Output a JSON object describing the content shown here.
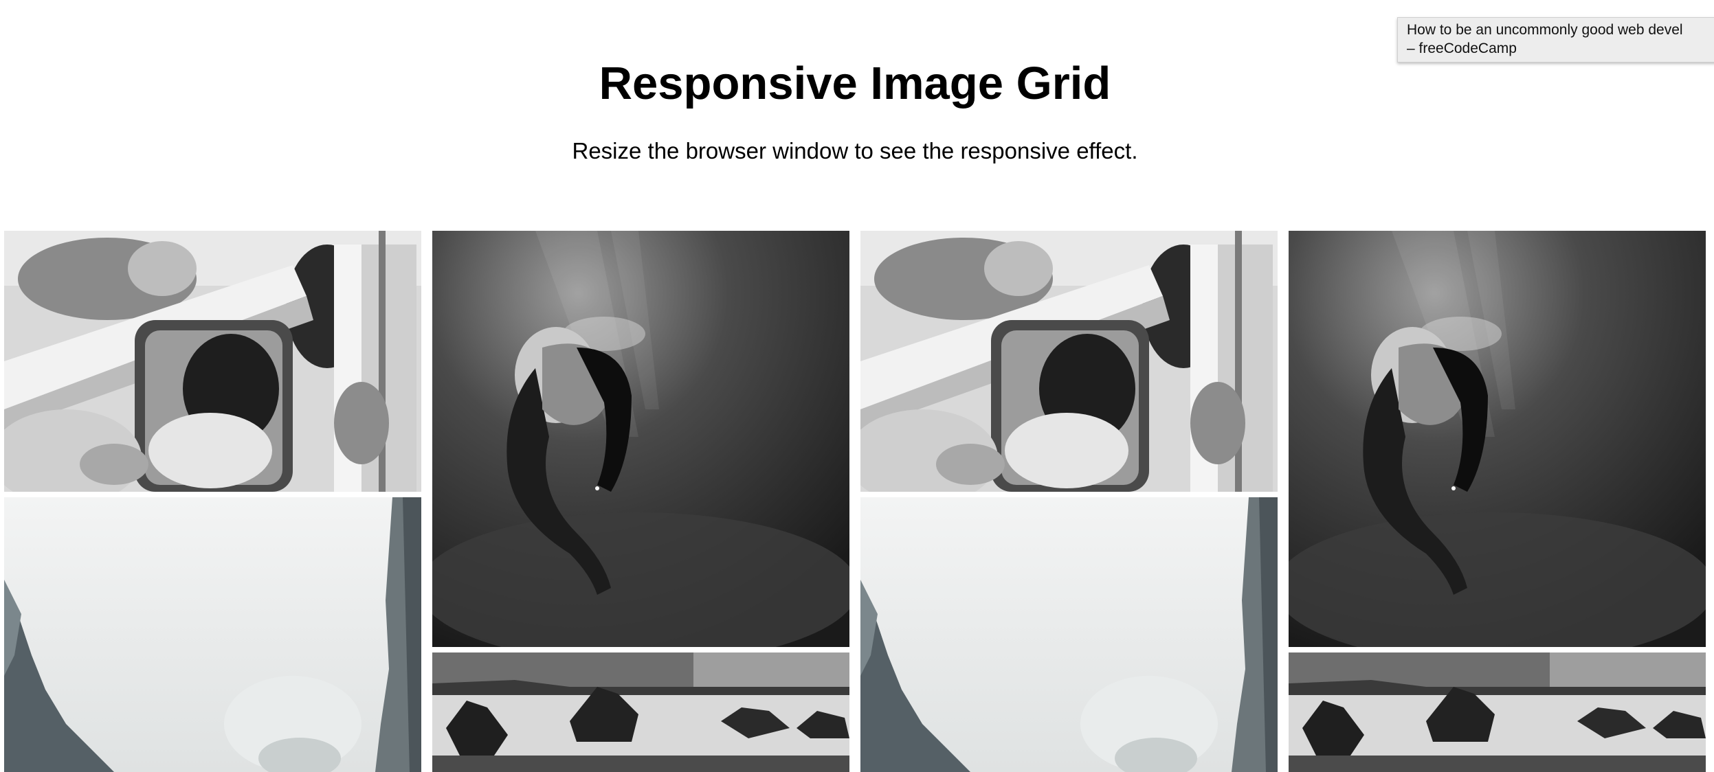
{
  "tooltip": {
    "line1": "How to be an uncommonly good web devel",
    "line2": "– freeCodeCamp"
  },
  "header": {
    "title": "Responsive Image Grid",
    "subtitle": "Resize the browser window to see the responsive effect."
  },
  "grid": {
    "columns": [
      {
        "images": [
          "wedding-car-photo",
          "foggy-cliff-photo"
        ]
      },
      {
        "images": [
          "underwater-woman-photo",
          "rocky-coast-photo"
        ]
      },
      {
        "images": [
          "wedding-car-photo",
          "foggy-cliff-photo"
        ]
      },
      {
        "images": [
          "underwater-woman-photo",
          "rocky-coast-photo"
        ]
      }
    ]
  }
}
